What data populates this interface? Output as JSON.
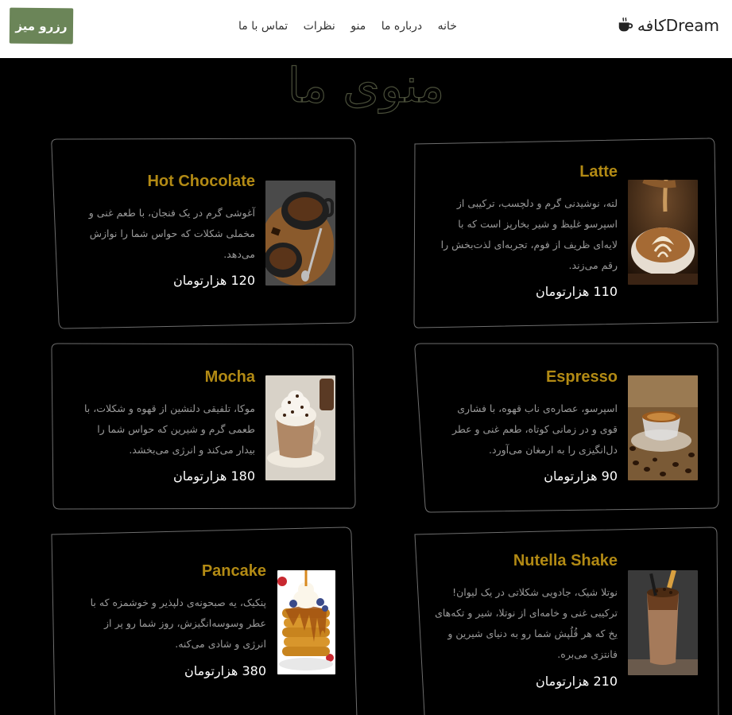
{
  "header": {
    "brand": "Dreamکافه",
    "reserve_label": "رزرو میز",
    "nav": [
      {
        "label": "خانه"
      },
      {
        "label": "درباره ما"
      },
      {
        "label": "منو"
      },
      {
        "label": "نظرات"
      },
      {
        "label": "تماس با ما"
      }
    ],
    "colors": {
      "reserve_button": "#6b8558",
      "header_bg": "#ffffff"
    }
  },
  "menu": {
    "title": "منوی ما",
    "accent_color": "#b28a14",
    "items": [
      {
        "name": "Latte",
        "description": "لته، نوشیدنی گرم و دلچسب، ترکیبی از اسپرسو غلیظ و شیر بخارپز است که با لایه‌ای ظریف از فوم، تجربه‌ای لذت‌بخش را رقم می‌زند.",
        "price": "110 هزارتومان",
        "image": "latte-art-cup-image"
      },
      {
        "name": "Hot Chocolate",
        "description": "آغوشی گرم در یک فنجان، با طعم غنی و مخملی شکلات که حواس شما را نوازش می‌دهد.",
        "price": "120 هزارتومان",
        "image": "hot-chocolate-mugs-image"
      },
      {
        "name": "Espresso",
        "description": "اسپرسو، عصاره‌ی ناب قهوه، با فشاری قوی و در زمانی کوتاه، طعم غنی و عطر دل‌انگیزی را به ارمغان می‌آورد.",
        "price": "90 هزارتومان",
        "image": "espresso-cup-beans-image"
      },
      {
        "name": "Mocha",
        "description": "موکا، تلفیقی دلنشین از قهوه و شکلات، با طعمی گرم و شیرین که حواس شما را بیدار می‌کند و انرژی می‌بخشد.",
        "price": "180 هزارتومان",
        "image": "mocha-glass-cream-image"
      },
      {
        "name": "Nutella Shake",
        "description": "نوتلا شیک، جادویی شکلاتی در یک لیوان! ترکیبی غنی و خامه‌ای از نوتلا، شیر و تکه‌های یخ که هر قُلُپش شما رو به دنیای شیرین و فانتزی می‌بره.",
        "price": "210 هزارتومان",
        "image": "nutella-shake-glass-image"
      },
      {
        "name": "Pancake",
        "description": "پنکیک، یه صبحونه‌ی دلپذیر و خوشمزه که با عطر وسوسه‌انگیزش، روز شما رو پر از انرژی و شادی می‌کنه.",
        "price": "380 هزارتومان",
        "image": "pancake-stack-image"
      }
    ]
  }
}
